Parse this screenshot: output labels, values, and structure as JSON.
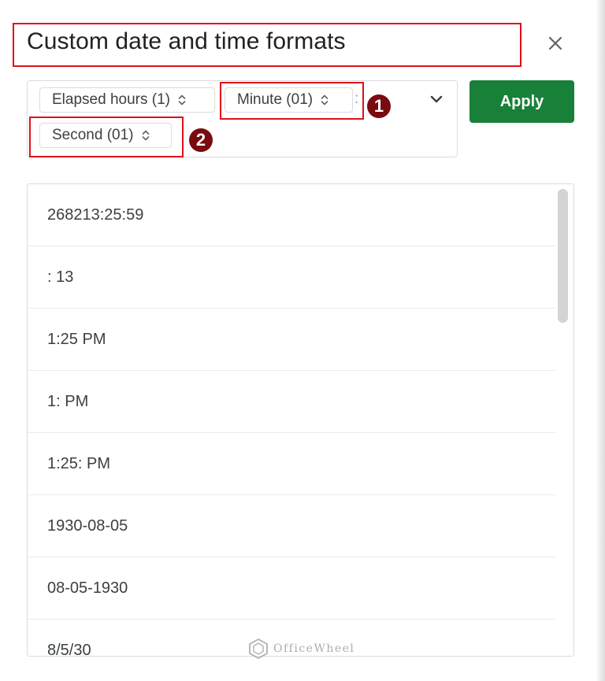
{
  "dialog": {
    "title": "Custom date and time formats",
    "close_icon": "close-icon"
  },
  "format_chips": [
    {
      "label": "Elapsed hours (1)",
      "icon": "unfold-icon"
    },
    {
      "label": "Minute (01)",
      "icon": "unfold-icon"
    },
    {
      "label": "Second (01)",
      "icon": "unfold-icon"
    }
  ],
  "separators": [
    ":",
    ":"
  ],
  "dropdown_icon": "chevron-down-icon",
  "apply_label": "Apply",
  "annotations": {
    "badge_1": "1",
    "badge_2": "2"
  },
  "formats_list": [
    "268213:25:59",
    ": 13",
    "1:25 PM",
    "1: PM",
    "1:25: PM",
    "1930-08-05",
    "08-05-1930",
    "8/5/30"
  ],
  "watermark": {
    "text": "OfficeWheel"
  },
  "colors": {
    "apply_bg": "#188038",
    "highlight_border": "#e0101a",
    "badge_bg": "#7a0a10"
  }
}
